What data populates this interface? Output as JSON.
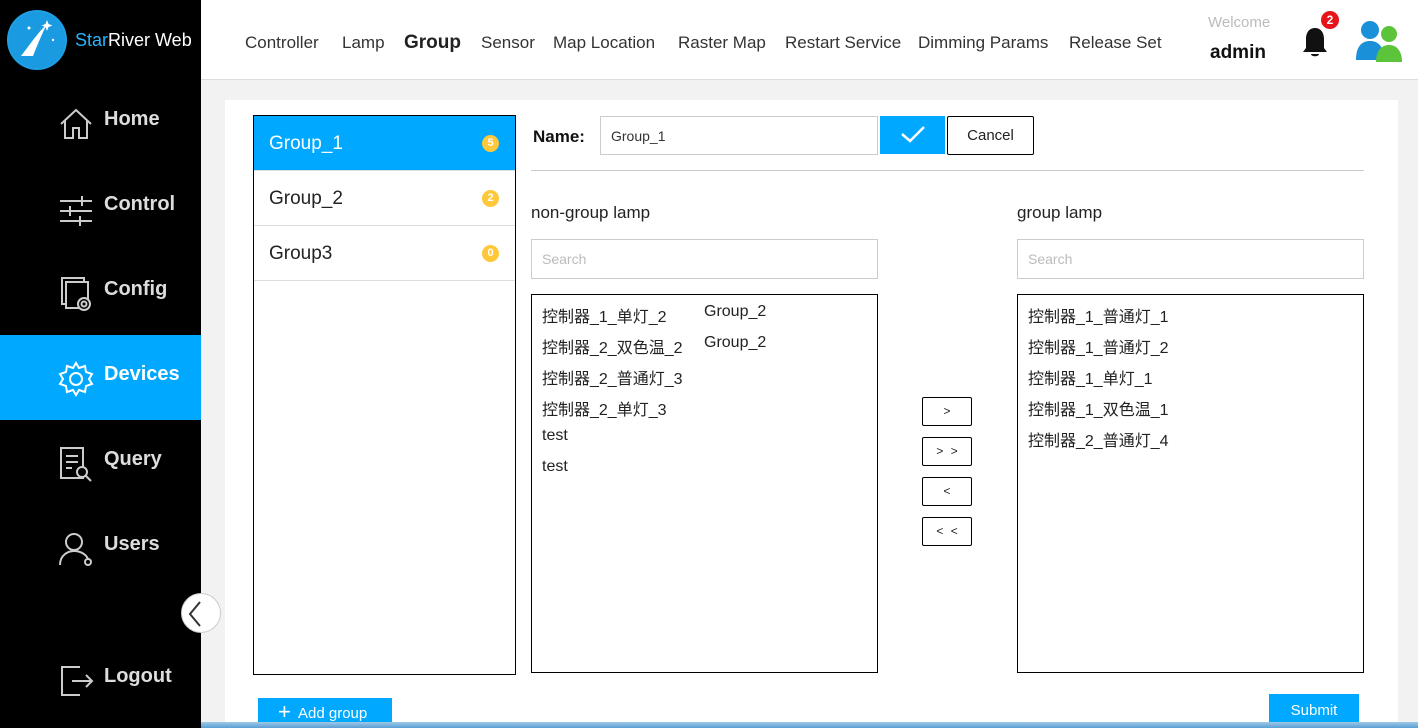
{
  "app": {
    "logo_prefix": "Star",
    "logo_suffix": "River Web"
  },
  "sidebar": {
    "items": [
      {
        "label": "Home",
        "icon": "home-icon"
      },
      {
        "label": "Control",
        "icon": "sliders-icon"
      },
      {
        "label": "Config",
        "icon": "config-icon"
      },
      {
        "label": "Devices",
        "icon": "gear-icon",
        "active": true
      },
      {
        "label": "Query",
        "icon": "document-search-icon"
      },
      {
        "label": "Users",
        "icon": "user-icon"
      },
      {
        "label": "Logout",
        "icon": "logout-icon"
      }
    ]
  },
  "topnav": {
    "tabs": [
      {
        "label": "Controller"
      },
      {
        "label": "Lamp"
      },
      {
        "label": "Group",
        "active": true
      },
      {
        "label": "Sensor"
      },
      {
        "label": "Map Location"
      },
      {
        "label": "Raster Map"
      },
      {
        "label": "Restart Service"
      },
      {
        "label": "Dimming Params"
      },
      {
        "label": "Release Set"
      }
    ],
    "welcome": "Welcome",
    "username": "admin",
    "notification_count": "2"
  },
  "groups": [
    {
      "name": "Group_1",
      "count": "5",
      "active": true
    },
    {
      "name": "Group_2",
      "count": "2"
    },
    {
      "name": "Group3",
      "count": "0"
    }
  ],
  "editor": {
    "name_label": "Name:",
    "name_value": "Group_1",
    "cancel_label": "Cancel"
  },
  "non_group": {
    "title": "non-group lamp",
    "search_placeholder": "Search",
    "lamps": [
      {
        "name": "控制器_1_单灯_2",
        "group": "Group_2"
      },
      {
        "name": "控制器_2_双色温_2",
        "group": "Group_2"
      },
      {
        "name": "控制器_2_普通灯_3",
        "group": ""
      },
      {
        "name": "控制器_2_单灯_3",
        "group": ""
      },
      {
        "name": "test",
        "group": ""
      },
      {
        "name": "test",
        "group": ""
      }
    ]
  },
  "group_lamp": {
    "title": "group lamp",
    "search_placeholder": "Search",
    "lamps": [
      {
        "name": "控制器_1_普通灯_1"
      },
      {
        "name": "控制器_1_普通灯_2"
      },
      {
        "name": "控制器_1_单灯_1"
      },
      {
        "name": "控制器_1_双色温_1"
      },
      {
        "name": "控制器_2_普通灯_4"
      }
    ]
  },
  "transfer": {
    "move_right": ">",
    "move_all_right": "> >",
    "move_left": "<",
    "move_all_left": "< <"
  },
  "actions": {
    "add_group": "Add group",
    "submit": "Submit"
  },
  "colors": {
    "accent": "#00a9ff",
    "sidebar_bg": "#000000",
    "count_badge": "#ffc73a",
    "alert_badge": "#e8141c"
  }
}
